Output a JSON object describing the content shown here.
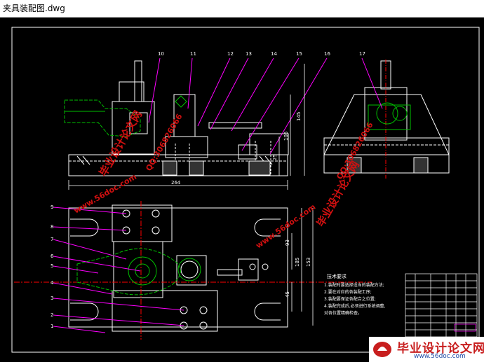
{
  "window": {
    "title": "夹具装配图.dwg"
  },
  "drawing": {
    "callouts_top": [
      "10",
      "11",
      "12",
      "13",
      "14",
      "15",
      "16",
      "17"
    ],
    "callouts_left": [
      "9",
      "8",
      "7",
      "6",
      "5",
      "4",
      "3",
      "2",
      "1"
    ],
    "dims": {
      "width_264": "264",
      "h_145": "145",
      "h_105": "105",
      "h_25": "25",
      "h_93": "93",
      "h_185": "185",
      "h_153": "153",
      "h_45": "45"
    },
    "notes": {
      "heading": "技术要求",
      "lines": [
        "1.装配时要选择适当的装配方法;",
        "2.要在对应的各装配工序;",
        "3.装配要保证各配合之位置;",
        "4.装配完成后,必须进行系统调整,",
        "  对各位置精确检查。"
      ]
    }
  },
  "watermarks": {
    "brand_cn": "毕业设计论文网",
    "qq": "QQ:306826066",
    "url": "www.56doc.com"
  },
  "footer_brand": {
    "name": "毕业设计论文网",
    "url": "www.56doc.com"
  },
  "colors": {
    "background": "#000000",
    "line": "#ffffff",
    "magenta": "#ff00ff",
    "green": "#00c000",
    "red": "#e01010",
    "watermark": "#d01010"
  }
}
